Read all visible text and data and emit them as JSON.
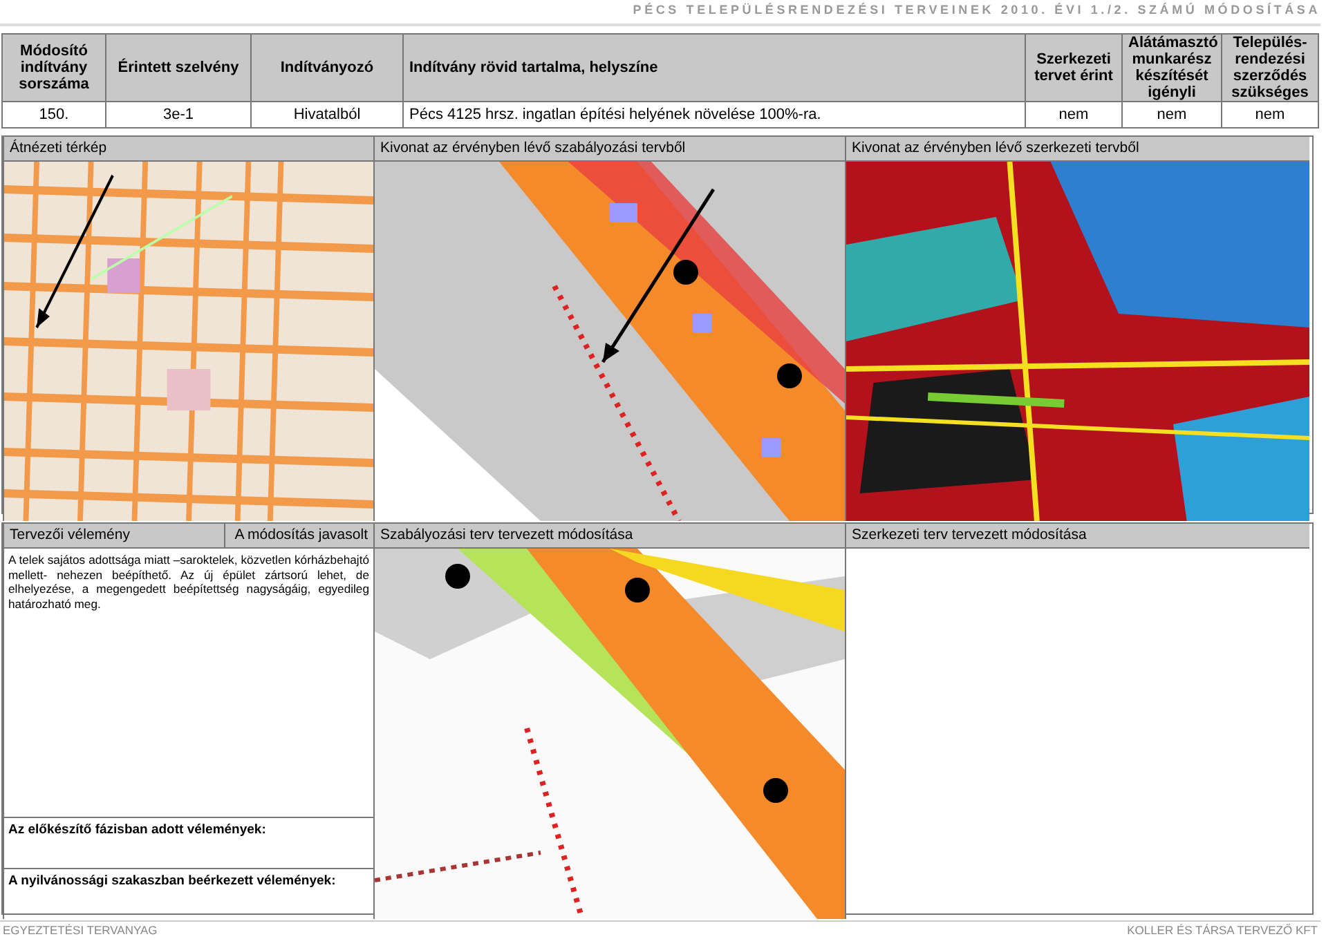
{
  "header": {
    "title": "PÉCS TELEPÜLÉSRENDEZÉSI TERVEINEK 2010. ÉVI 1./2. SZÁMÚ MÓDOSÍTÁSA"
  },
  "request_table": {
    "columns": [
      "Módosító indítvány sorszáma",
      "Érintett szelvény",
      "Indítványozó",
      "Indítvány rövid tartalma, helyszíne",
      "Szerkezeti tervet érint",
      "Alátámasztó munkarész készítését igényli",
      "Település-rendezési szerződés szükséges"
    ],
    "rows": [
      [
        "150.",
        "3e-1",
        "Hivatalból",
        "Pécs 4125 hrsz. ingatlan építési helyének növelése 100%-ra.",
        "nem",
        "nem",
        "nem"
      ]
    ]
  },
  "overview_panels": [
    {
      "title": "Átnézeti térkép",
      "kind": "overview"
    },
    {
      "title": "Kivonat az érvényben lévő szabályozási tervből",
      "kind": "regulation"
    },
    {
      "title": "Kivonat az érvényben lévő szerkezeti tervből",
      "kind": "structure"
    }
  ],
  "opinion": {
    "title": "Tervezői vélemény",
    "verdict": "A módosítás javasolt",
    "text": "A telek sajátos adottsága miatt –saroktelek, közvetlen kórházbehajtó mellett- nehezen beépíthető. Az új épület zártsorú lehet, de elhelyezése, a megengedett beépítettség nagyságáig, egyedileg határozható meg.",
    "preparatory_label": "Az előkészítő fázisban adott vélemények:",
    "public_label": "A nyilvánossági szakaszban beérkezett vélemények:"
  },
  "proposed_panels": [
    {
      "title": "Szabályozási terv tervezett módosítása",
      "kind": "proposed"
    },
    {
      "title": "Szerkezeti terv tervezett módosítása",
      "kind": "empty"
    }
  ],
  "footer": {
    "left": "EGYEZTETÉSI TERVANYAG",
    "right": "KOLLER ÉS TÁRSA TERVEZŐ KFT"
  }
}
